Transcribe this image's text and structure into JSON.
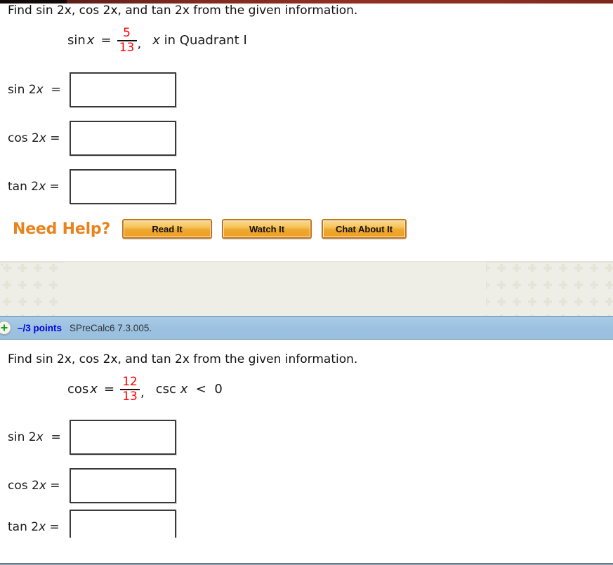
{
  "page": {
    "background_color": "#ffffff",
    "top_bar_color": "#8d2e21"
  },
  "questions": [
    {
      "prompt_pre": "Find sin 2",
      "prompt": "Find sin 2x, cos 2x, and tan 2x from the given information.",
      "equation": {
        "function": "sin",
        "variable": "x",
        "operator": "=",
        "fraction": {
          "numerator": "5",
          "denominator": "13",
          "color": "#ff0000"
        },
        "comma": ",",
        "condition": "x in Quadrant I"
      },
      "answers": [
        {
          "label_func": "sin 2",
          "label_var": "x",
          "label_eq": " =",
          "value": "",
          "placeholder": ""
        },
        {
          "label_func": "cos 2",
          "label_var": "x",
          "label_eq": " =",
          "value": "",
          "placeholder": ""
        },
        {
          "label_func": "tan 2",
          "label_var": "x",
          "label_eq": " =",
          "value": "",
          "placeholder": ""
        }
      ],
      "need_help": {
        "label": "Need Help?",
        "buttons": [
          {
            "label": "Read It"
          },
          {
            "label": "Watch It"
          },
          {
            "label": "Chat About It"
          }
        ]
      }
    },
    {
      "header": {
        "icon": "plus-circle-icon",
        "points": "–/3 points",
        "code": "SPreCalc6 7.3.005.",
        "points_color": "#0000dd",
        "bar_color": "#9cc2e1"
      },
      "prompt": "Find sin 2x, cos 2x, and tan 2x from the given information.",
      "equation": {
        "function": "cos",
        "variable": "x",
        "operator": "=",
        "fraction": {
          "numerator": "12",
          "denominator": "13",
          "color": "#ff0000"
        },
        "comma": ",",
        "condition": "csc x < 0"
      },
      "answers": [
        {
          "label_func": "sin 2",
          "label_var": "x",
          "label_eq": " =",
          "value": "",
          "placeholder": ""
        },
        {
          "label_func": "cos 2",
          "label_var": "x",
          "label_eq": " =",
          "value": "",
          "placeholder": ""
        },
        {
          "label_func": "tan 2",
          "label_var": "x",
          "label_eq": " =",
          "value": "",
          "placeholder": ""
        }
      ]
    }
  ]
}
